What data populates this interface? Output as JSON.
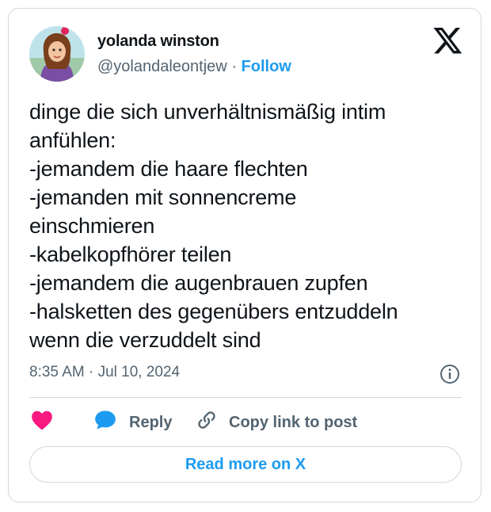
{
  "author": {
    "name": "yolanda winston",
    "handle": "@yolandaleontjew",
    "separator": "·",
    "follow_label": "Follow"
  },
  "tweet": {
    "text": "dinge die sich unverhältnismäßig intim\nanfühlen:\n-jemandem die haare flechten\n-jemanden mit sonnencreme\neinschmieren\n-kabelkopfhörer teilen\n-jemandem die augenbrauen zupfen\n-halsketten des gegenübers entzuddeln\nwenn die verzuddelt sind",
    "timestamp": "8:35 AM · Jul 10, 2024"
  },
  "actions": {
    "reply_label": "Reply",
    "copy_label": "Copy link to post",
    "read_more_label": "Read more on X"
  },
  "icons": {
    "logo": "x-logo",
    "like": "heart-icon",
    "reply": "speech-bubble-icon",
    "copy": "link-icon",
    "info": "info-icon"
  },
  "colors": {
    "accent": "#1d9bf0",
    "heart": "#f91880",
    "text": "#0f1419",
    "muted": "#536471",
    "border": "#cfd9de"
  }
}
